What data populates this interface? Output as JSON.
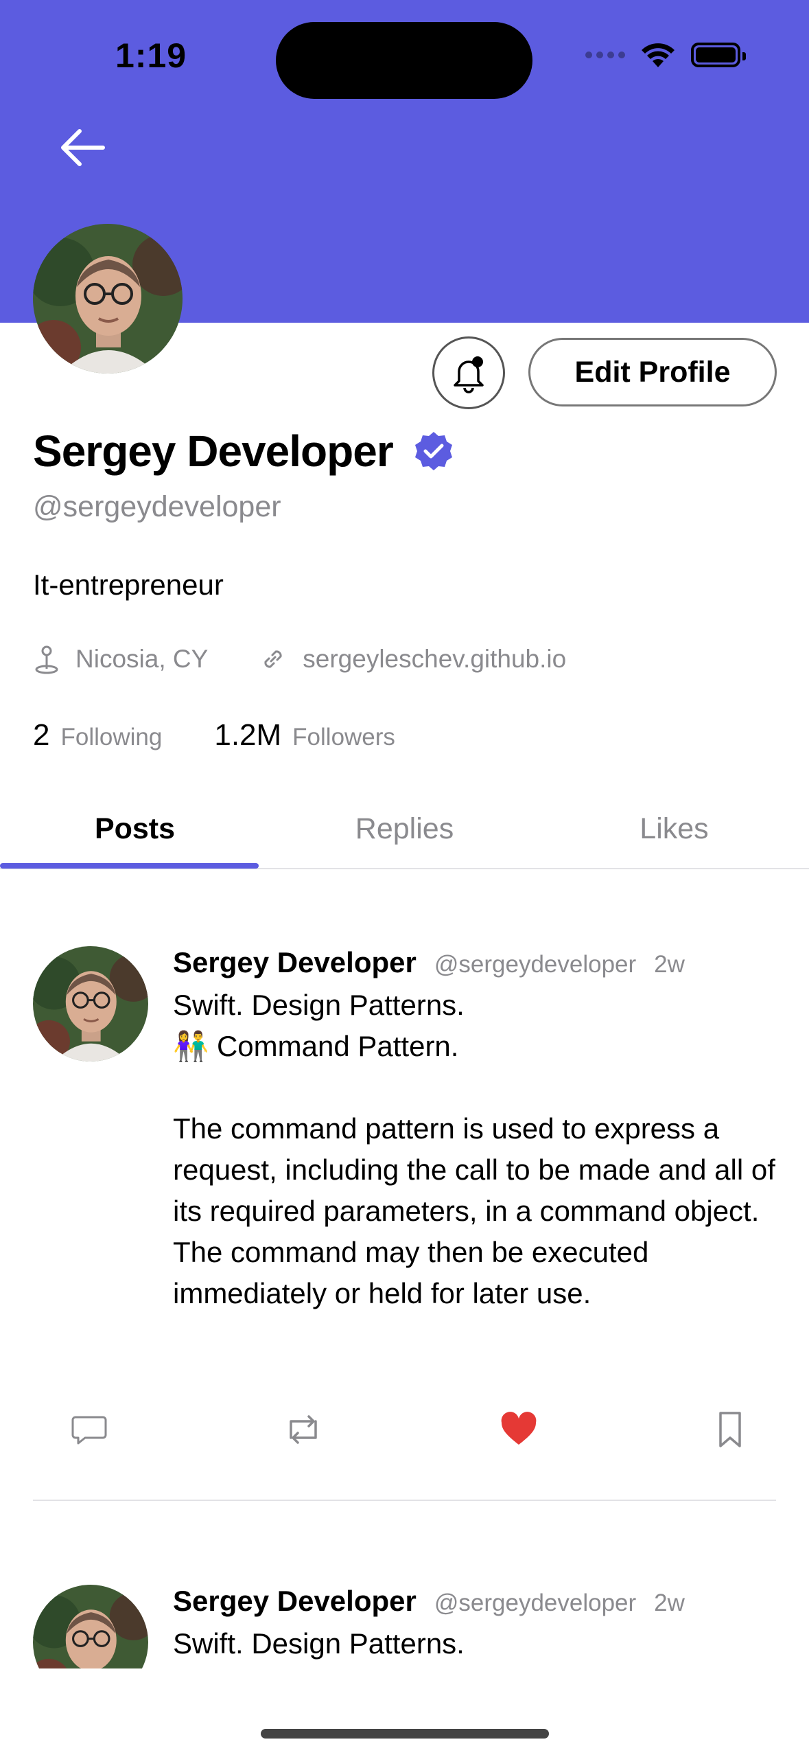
{
  "status_bar": {
    "time": "1:19",
    "icons": [
      "signal-icon",
      "wifi-icon",
      "battery-icon"
    ]
  },
  "colors": {
    "accent": "#5c5ce0",
    "like": "#e53935",
    "muted": "#8a8a8e"
  },
  "header": {
    "back_icon": "arrow-left-icon"
  },
  "profile": {
    "name": "Sergey Developer",
    "verified_icon": "verified-badge-icon",
    "handle": "@sergeydeveloper",
    "bio": "It-entrepreneur",
    "location": "Nicosia, CY",
    "website": "sergeyleschev.github.io",
    "following_count": "2",
    "following_label": "Following",
    "followers_count": "1.2M",
    "followers_label": "Followers",
    "edit_button_label": "Edit Profile",
    "notify_icon": "bell-icon"
  },
  "tabs": [
    {
      "label": "Posts",
      "active": true
    },
    {
      "label": "Replies",
      "active": false
    },
    {
      "label": "Likes",
      "active": false
    }
  ],
  "posts": [
    {
      "name": "Sergey Developer",
      "handle": "@sergeydeveloper",
      "time": "2w",
      "text": "Swift. Design Patterns.\n👫 Command Pattern.\n\nThe command pattern is used to express a request, including the call to be made and all of its required parameters, in a command object. The command may then be executed immediately or held for later use.",
      "liked": true
    },
    {
      "name": "Sergey Developer",
      "handle": "@sergeydeveloper",
      "time": "2w",
      "text": "Swift. Design Patterns."
    }
  ]
}
